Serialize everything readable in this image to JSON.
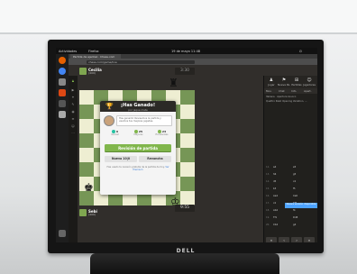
{
  "topbar": {
    "activities": "Actividades",
    "app": "Firefox",
    "datetime": "19 de mayo 11:48"
  },
  "browser": {
    "tab_title": "Partida de ajedrez · Chess.com",
    "url": "chess.com/game/live"
  },
  "players": {
    "top_name": "Cecilia",
    "top_rating": "(400)",
    "top_clock": "3:30",
    "bottom_name": "Sebí",
    "bottom_rating": "(400)",
    "bottom_clock": "9:55"
  },
  "modal": {
    "title": "¡Has Ganado!",
    "subtitle": "por jaque mate",
    "coach_text": "Has ganado! Revisemos la partida y veamos tus mejores jugadas.",
    "stats": [
      {
        "value": "6",
        "label": "Genial",
        "color": "#26c2a3"
      },
      {
        "value": "25",
        "label": "Mejores",
        "color": "#81b64c"
      },
      {
        "value": "23",
        "label": "Excelentes",
        "color": "#81b64c"
      }
    ],
    "review_button": "Revisión de partida",
    "new_button": "Nueva 10|0",
    "rematch_button": "Revancha",
    "footnote": "Has usado tu revisión gratuita de la partida de hoy.",
    "footnote_link": "Ver Premium"
  },
  "sidepanel": {
    "tabs": [
      {
        "icon": "♟",
        "label": "Jugar"
      },
      {
        "icon": "⚑",
        "label": "Nueva Pa."
      },
      {
        "icon": "⊞",
        "label": "Partidas"
      },
      {
        "icon": "☺",
        "label": "Jugadores"
      }
    ],
    "subtabs": [
      "Mov.",
      "Chat",
      "Info.",
      "Apert."
    ],
    "line1": "Italiana · Apertura Giuoco",
    "line2": "Quattro Pezzi Opening Variation, ...",
    "moves": [
      {
        "n": "12.",
        "w": "a4",
        "b": "e5"
      },
      {
        "n": "13.",
        "w": "h6",
        "b": "g5"
      },
      {
        "n": "14.",
        "w": "d5",
        "b": "c4"
      },
      {
        "n": "15.",
        "w": "b3",
        "b": "f5"
      },
      {
        "n": "16.",
        "w": "Aa4",
        "b": "Ce6"
      },
      {
        "n": "17.",
        "w": "c4",
        "b": "Tf8"
      },
      {
        "n": "18.",
        "w": "Ab4",
        "b": "f4"
      },
      {
        "n": "19.",
        "w": "Tf1",
        "b": "Dd8"
      },
      {
        "n": "20.",
        "w": "Cb4",
        "b": "g4"
      }
    ],
    "nav": [
      "«",
      "‹",
      "›",
      "»"
    ],
    "notif": "Nueva versión disponible"
  }
}
